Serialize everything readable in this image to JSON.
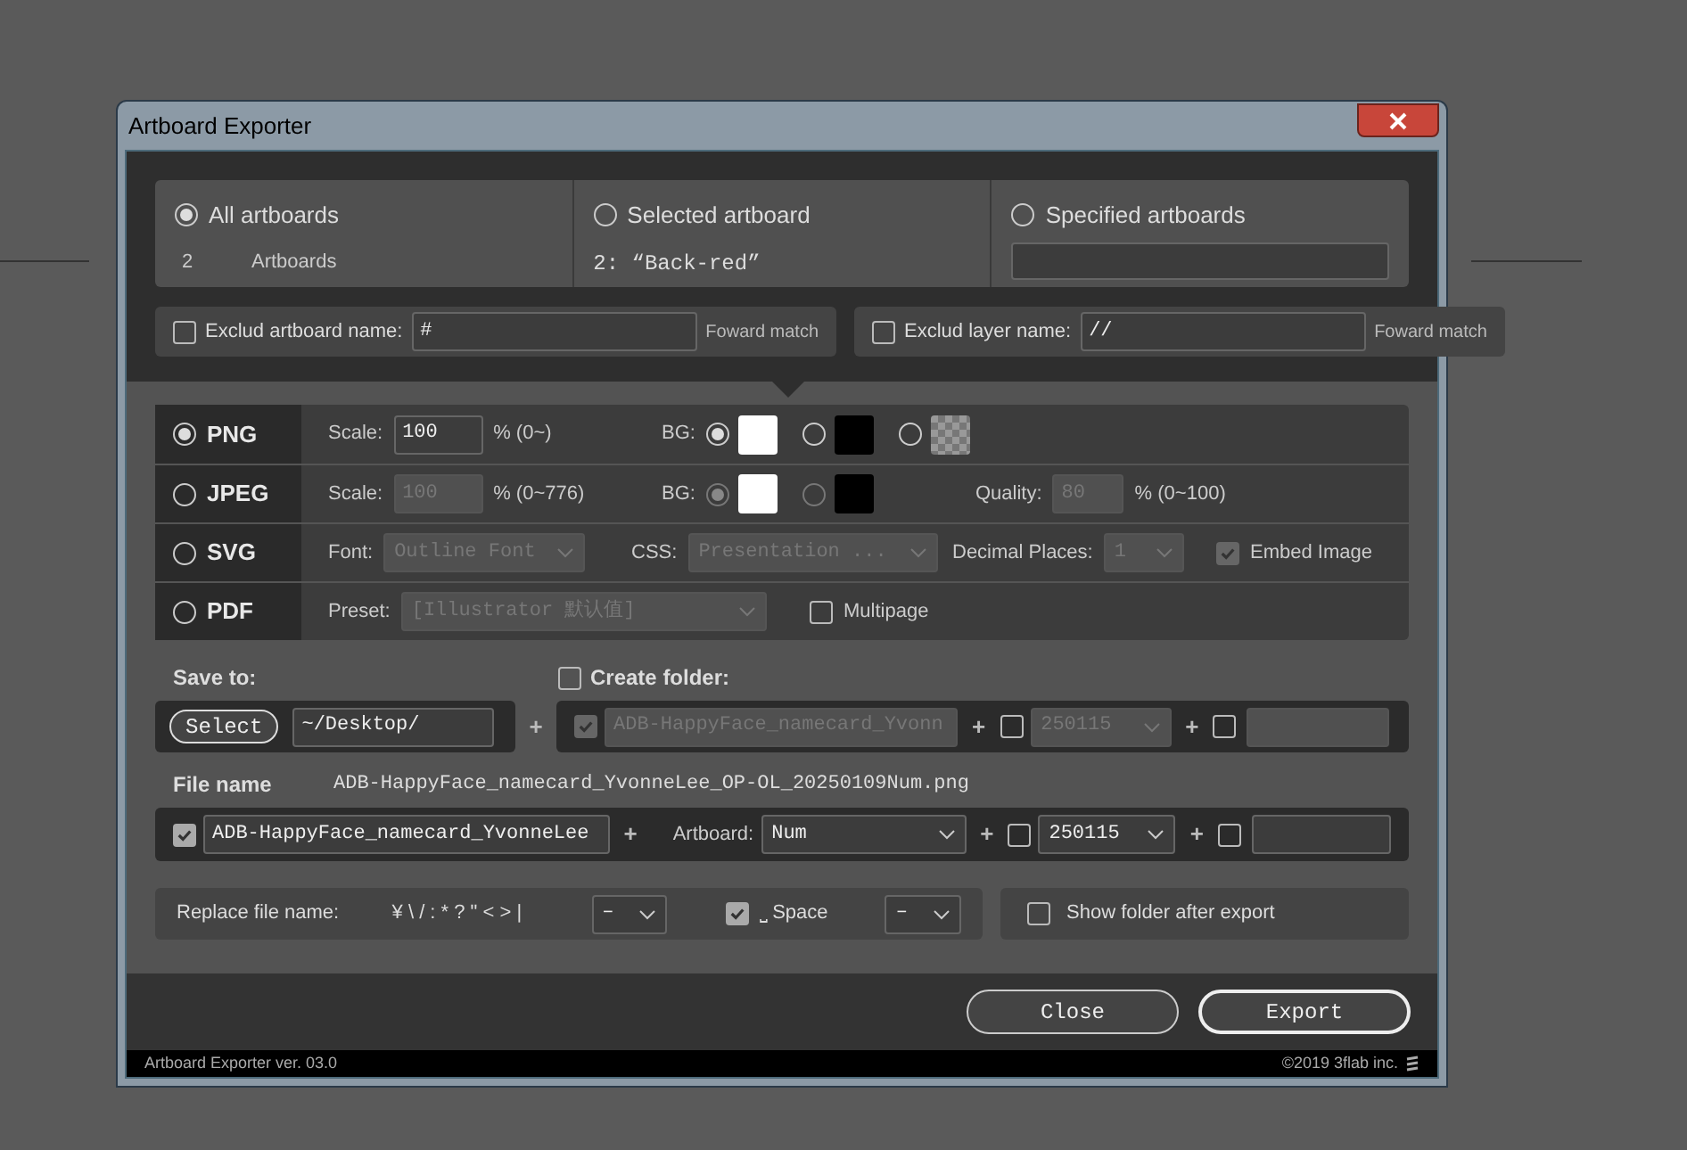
{
  "window": {
    "title": "Artboard Exporter"
  },
  "scope": [
    {
      "label": "All artboards",
      "selected": true,
      "kind": "count",
      "count": "2",
      "unit": "Artboards"
    },
    {
      "label": "Selected artboard",
      "selected": false,
      "kind": "text",
      "text": "2: “Back-red”"
    },
    {
      "label": "Specified artboards",
      "selected": false,
      "kind": "field"
    }
  ],
  "exclude": [
    {
      "label": "Exclud artboard name:",
      "checked": false,
      "value": "#",
      "hint": "Foward match"
    },
    {
      "label": "Exclud layer name:",
      "checked": false,
      "value": "//",
      "hint": "Foward match"
    }
  ],
  "formats": [
    {
      "label": "PNG",
      "selected": true,
      "fields": [
        {
          "kind": "input",
          "label": "Scale:",
          "value": "100",
          "suffix": "% (0~)",
          "disabled": false
        },
        {
          "kind": "bg",
          "label": "BG:",
          "disabled": false,
          "options": [
            {
              "kind": "solid",
              "color": "#ffffff",
              "selected": true
            },
            {
              "kind": "solid",
              "color": "#000000",
              "selected": false
            },
            {
              "kind": "checker",
              "selected": false
            }
          ]
        }
      ]
    },
    {
      "label": "JPEG",
      "selected": false,
      "fields": [
        {
          "kind": "input",
          "label": "Scale:",
          "value": "100",
          "suffix": "% (0~776)",
          "disabled": true
        },
        {
          "kind": "bg",
          "label": "BG:",
          "disabled": true,
          "options": [
            {
              "kind": "solid",
              "color": "#ffffff",
              "selected": true
            },
            {
              "kind": "solid",
              "color": "#000000",
              "selected": false
            }
          ]
        },
        {
          "kind": "input",
          "label": "Quality:",
          "value": "80",
          "suffix": "% (0~100)",
          "disabled": true
        }
      ]
    },
    {
      "label": "SVG",
      "selected": false,
      "fields": [
        {
          "kind": "select",
          "label": "Font:",
          "value": "Outline Font",
          "disabled": true
        },
        {
          "kind": "select",
          "label": "CSS:",
          "value": "Presentation ...",
          "disabled": true
        },
        {
          "kind": "select",
          "label": "Decimal Places:",
          "value": "1",
          "disabled": true
        },
        {
          "kind": "check",
          "label": "Embed Image",
          "checked": true,
          "disabled": true
        }
      ]
    },
    {
      "label": "PDF",
      "selected": false,
      "fields": [
        {
          "kind": "select",
          "label": "Preset:",
          "value": "[Illustrator 默认值]",
          "disabled": true
        },
        {
          "kind": "check",
          "label": "Multipage",
          "checked": false,
          "disabled": false
        }
      ]
    }
  ],
  "save_to": {
    "label": "Save to:",
    "button": "Select",
    "path": "~/Desktop/",
    "plus": "+",
    "create_folder": {
      "label": "Create folder:",
      "checked": false
    },
    "folder_parts": {
      "name_checked": true,
      "name": "ADB-HappyFace_namecard_Yvonn",
      "date_checked": false,
      "date": "250115",
      "extra_checked": false,
      "disabled": true
    }
  },
  "file_name": {
    "label": "File name",
    "preview": "ADB-HappyFace_namecard_YvonneLee_OP-OL_20250109Num.png",
    "name_checked": true,
    "name": "ADB-HappyFace_namecard_YvonneLee",
    "artboard_label": "Artboard:",
    "artboard": "Num",
    "date_checked": false,
    "date": "250115",
    "extra_checked": false,
    "disabled": false
  },
  "replace": {
    "label": "Replace file name:",
    "chars": "¥ \\ / : * ? \" < > |",
    "char_sub": "–",
    "space_checked": true,
    "space_label": "⎵ Space",
    "space_sub": "–"
  },
  "show_folder": {
    "label": "Show folder after export",
    "checked": false
  },
  "buttons": [
    "Close",
    "Export"
  ],
  "status": {
    "version": "Artboard Exporter ver. 03.0",
    "copyright": "©2019 3flab inc."
  }
}
